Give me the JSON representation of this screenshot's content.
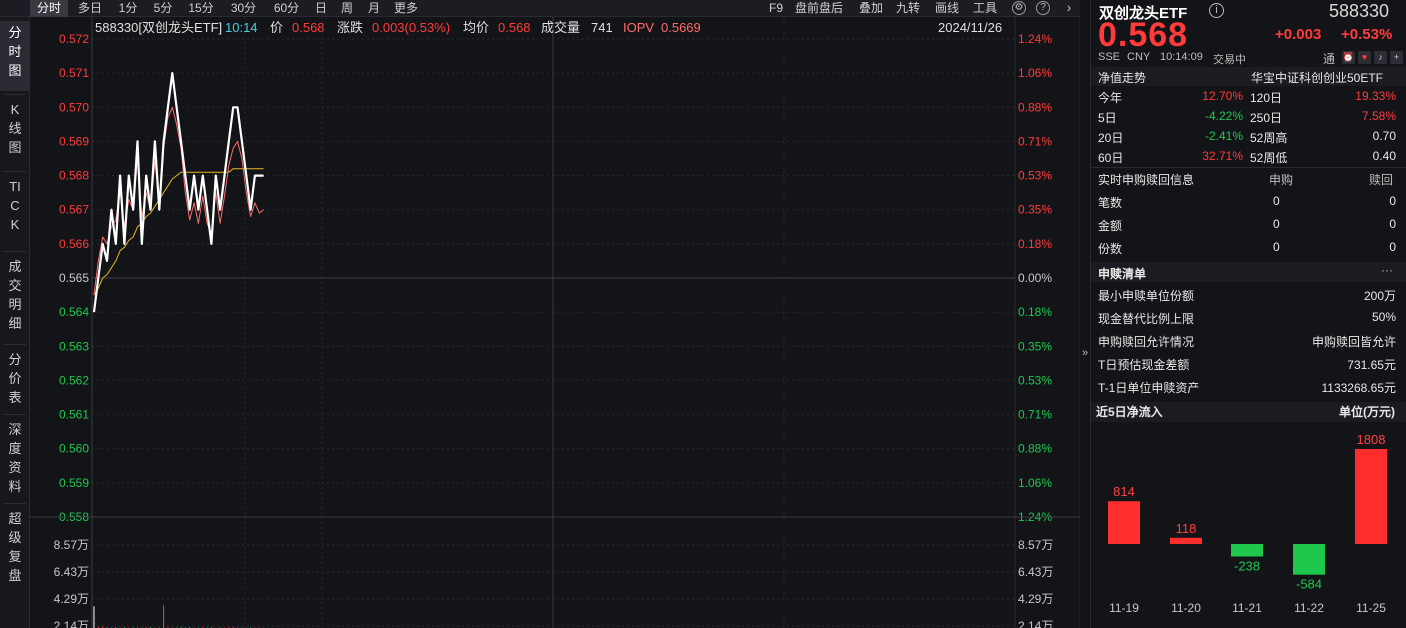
{
  "toolbar": {
    "left": [
      {
        "id": "fenshi",
        "label": "分时",
        "active": true
      },
      {
        "id": "duori",
        "label": "多日"
      },
      {
        "id": "1fen",
        "label": "1分"
      },
      {
        "id": "5fen",
        "label": "5分"
      },
      {
        "id": "15fen",
        "label": "15分"
      },
      {
        "id": "30fen",
        "label": "30分"
      },
      {
        "id": "60fen",
        "label": "60分"
      },
      {
        "id": "ri",
        "label": "日"
      },
      {
        "id": "zhou",
        "label": "周"
      },
      {
        "id": "yue",
        "label": "月"
      },
      {
        "id": "gengduo",
        "label": "更多"
      }
    ],
    "right": [
      {
        "id": "f9",
        "label": "F9"
      },
      {
        "id": "pqph",
        "label": "盘前盘后"
      },
      {
        "id": "diejia",
        "label": "叠加"
      },
      {
        "id": "jiuzhuan",
        "label": "九转"
      },
      {
        "id": "huaxian",
        "label": "画线"
      },
      {
        "id": "gongju",
        "label": "工具"
      }
    ],
    "icons": [
      "settings-icon",
      "help-icon",
      "more-icon"
    ]
  },
  "left_tabs": [
    {
      "id": "fenshitu",
      "label": "分时图",
      "active": true
    },
    {
      "id": "kxiantu",
      "label": "K线图"
    },
    {
      "id": "tick",
      "label": "TICK"
    },
    {
      "id": "chengjiao",
      "label": "成交明细"
    },
    {
      "id": "fenjia",
      "label": "分价表"
    },
    {
      "id": "shendu",
      "label": "深度资料"
    },
    {
      "id": "chaoji",
      "label": "超级复盘"
    }
  ],
  "info": {
    "code_name": "588330[双创龙头ETF]",
    "time": "10:14",
    "price_label": "价",
    "price": "0.568",
    "change_label": "涨跌",
    "change": "0.003(0.53%)",
    "avg_label": "均价",
    "avg": "0.568",
    "vol_label": "成交量",
    "vol": "741",
    "iopv_label": "IOPV",
    "iopv": "0.5669",
    "date": "2024/11/26"
  },
  "colors": {
    "up": "#ff3b3b",
    "down": "#1fc74d",
    "price_line": "#ffffff",
    "avg_line": "#e6b422",
    "iopv_line": "#ff6b6b",
    "grid": "#2a2a2e"
  },
  "chart_data": [
    {
      "type": "line",
      "ylim": [
        0.558,
        0.572
      ],
      "price_ticks": [
        "0.572",
        "0.571",
        "0.570",
        "0.569",
        "0.568",
        "0.567",
        "0.566",
        "0.565",
        "0.564",
        "0.563",
        "0.562",
        "0.561",
        "0.560",
        "0.559",
        "0.558"
      ],
      "pct_ticks": [
        "1.24%",
        "1.06%",
        "0.88%",
        "0.71%",
        "0.53%",
        "0.35%",
        "0.18%",
        "0.00%",
        "0.18%",
        "0.35%",
        "0.53%",
        "0.71%",
        "0.88%",
        "1.06%",
        "1.24%"
      ],
      "series": [
        {
          "values": [
            0.564,
            0.565,
            0.566,
            0.5655,
            0.567,
            0.566,
            0.568,
            0.566,
            0.568,
            0.567,
            0.569,
            0.566,
            0.568,
            0.567,
            0.569,
            0.567,
            0.569,
            0.57,
            0.571,
            0.57,
            0.569,
            0.568,
            0.567,
            0.568,
            0.567,
            0.568,
            0.567,
            0.566,
            0.568,
            0.567,
            0.568,
            0.569,
            0.57,
            0.57,
            0.569,
            0.568,
            0.567,
            0.568,
            0.568,
            0.568
          ]
        },
        {
          "values": [
            0.5645,
            0.5647,
            0.565,
            0.5651,
            0.5653,
            0.5655,
            0.5658,
            0.5659,
            0.5661,
            0.5662,
            0.5665,
            0.5666,
            0.5668,
            0.5669,
            0.5671,
            0.5673,
            0.5675,
            0.5677,
            0.5679,
            0.568,
            0.5681,
            0.5681,
            0.5681,
            0.5681,
            0.5681,
            0.5681,
            0.5681,
            0.5681,
            0.5681,
            0.5681,
            0.5681,
            0.5681,
            0.5682,
            0.5682,
            0.5682,
            0.5682,
            0.5682,
            0.5682,
            0.5682,
            0.5682
          ]
        },
        {
          "values": [
            0.5645,
            0.5655,
            0.5662,
            0.566,
            0.5665,
            0.5667,
            0.5675,
            0.5665,
            0.5673,
            0.567,
            0.5685,
            0.5668,
            0.5675,
            0.567,
            0.5684,
            0.5673,
            0.5688,
            0.5697,
            0.57,
            0.5695,
            0.5688,
            0.5675,
            0.5667,
            0.5672,
            0.5666,
            0.5674,
            0.5666,
            0.5663,
            0.5675,
            0.5666,
            0.5674,
            0.5683,
            0.5688,
            0.569,
            0.5685,
            0.5675,
            0.5668,
            0.5672,
            0.5669,
            0.567
          ]
        }
      ],
      "volume_ticks": [
        "8.57万",
        "6.43万",
        "4.29万",
        "2.14万"
      ],
      "volume_values": [
        21000,
        900,
        1400,
        600,
        500,
        800,
        400,
        700,
        300,
        500,
        600,
        400,
        700,
        800,
        300,
        500,
        22000,
        700,
        400,
        500,
        900,
        600,
        800,
        300,
        400,
        600,
        500,
        700,
        300,
        500,
        400,
        600,
        900,
        500,
        400,
        300,
        600,
        500,
        400,
        300
      ],
      "volume_ylim": [
        0,
        107000
      ]
    },
    {
      "type": "bar",
      "title": "近5日净流入",
      "unit": "单位(万元)",
      "categories": [
        "11-19",
        "11-20",
        "11-21",
        "11-22",
        "11-25"
      ],
      "values": [
        814,
        118,
        -238,
        -584,
        1808
      ],
      "labels": [
        "814",
        "118",
        "-238",
        "-584",
        "1808"
      ]
    }
  ],
  "rpanel": {
    "name": "双创龙头ETF",
    "code": "588330",
    "price": "0.568",
    "change": "+0.003",
    "change_pct": "+0.53%",
    "exchange": "SSE",
    "currency": "CNY",
    "time": "10:14:09",
    "status": "交易中",
    "tong_label": "通",
    "nav_title": "净值走势",
    "tracking_index": "华宝中证科创创业50ETF",
    "perf": [
      {
        "l1": "今年",
        "v1": "12.70%",
        "c1": "up",
        "l2": "120日",
        "v2": "19.33%",
        "c2": "up"
      },
      {
        "l1": "5日",
        "v1": "-4.22%",
        "c1": "down",
        "l2": "250日",
        "v2": "7.58%",
        "c2": "up"
      },
      {
        "l1": "20日",
        "v1": "-2.41%",
        "c1": "down",
        "l2": "52周高",
        "v2": "0.70",
        "c2": "plain"
      },
      {
        "l1": "60日",
        "v1": "32.71%",
        "c1": "up",
        "l2": "52周低",
        "v2": "0.40",
        "c2": "plain"
      }
    ],
    "realtime_title": "实时申购赎回信息",
    "sg_label": "申购",
    "sh_label": "赎回",
    "realtime_rows": [
      {
        "label": "笔数",
        "sg": "0",
        "sh": "0"
      },
      {
        "label": "金额",
        "sg": "0",
        "sh": "0"
      },
      {
        "label": "份数",
        "sg": "0",
        "sh": "0"
      }
    ],
    "list_title": "申赎清单",
    "list_more": "···",
    "list_rows": [
      {
        "label": "最小申赎单位份额",
        "value": "200万"
      },
      {
        "label": "现金替代比例上限",
        "value": "50%"
      },
      {
        "label": "申购赎回允许情况",
        "value": "申购赎回皆允许"
      },
      {
        "label": "T日预估现金差额",
        "value": "731.65元"
      },
      {
        "label": "T-1日单位申赎资产",
        "value": "1133268.65元"
      }
    ]
  }
}
